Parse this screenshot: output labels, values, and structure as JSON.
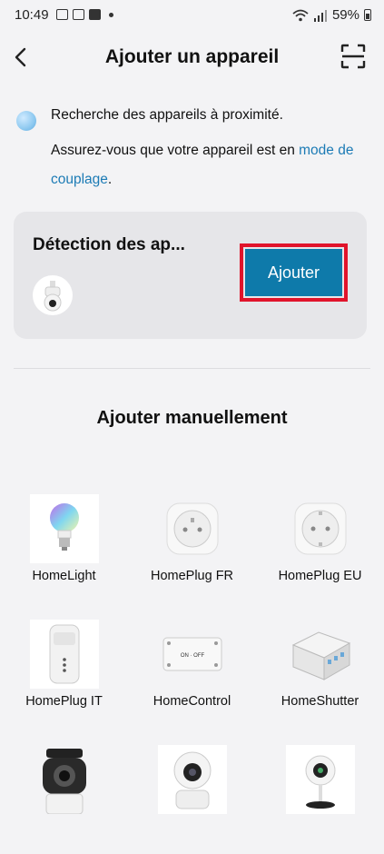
{
  "status_bar": {
    "time": "10:49",
    "battery": "59%"
  },
  "header": {
    "title": "Ajouter un appareil"
  },
  "intro": {
    "line1": "Recherche des appareils à proximité.",
    "line2_prefix": "Assurez-vous que votre appareil est en ",
    "line2_link": "mode de couplage",
    "line2_suffix": "."
  },
  "detection": {
    "title": "Détection des ap...",
    "add_button": "Ajouter"
  },
  "manual": {
    "title": "Ajouter manuellement",
    "devices": [
      {
        "label": "HomeLight",
        "icon": "bulb-icon"
      },
      {
        "label": "HomePlug FR",
        "icon": "plug-fr-icon"
      },
      {
        "label": "HomePlug EU",
        "icon": "plug-eu-icon"
      },
      {
        "label": "HomePlug IT",
        "icon": "plug-it-icon"
      },
      {
        "label": "HomeControl",
        "icon": "switch-module-icon"
      },
      {
        "label": "HomeShutter",
        "icon": "shutter-module-icon"
      },
      {
        "label": "",
        "icon": "outdoor-camera-icon"
      },
      {
        "label": "",
        "icon": "indoor-camera-icon"
      },
      {
        "label": "",
        "icon": "stand-camera-icon"
      }
    ]
  },
  "colors": {
    "accent": "#0e7aaa",
    "link": "#1c7bb5",
    "highlight": "#e0142b"
  }
}
